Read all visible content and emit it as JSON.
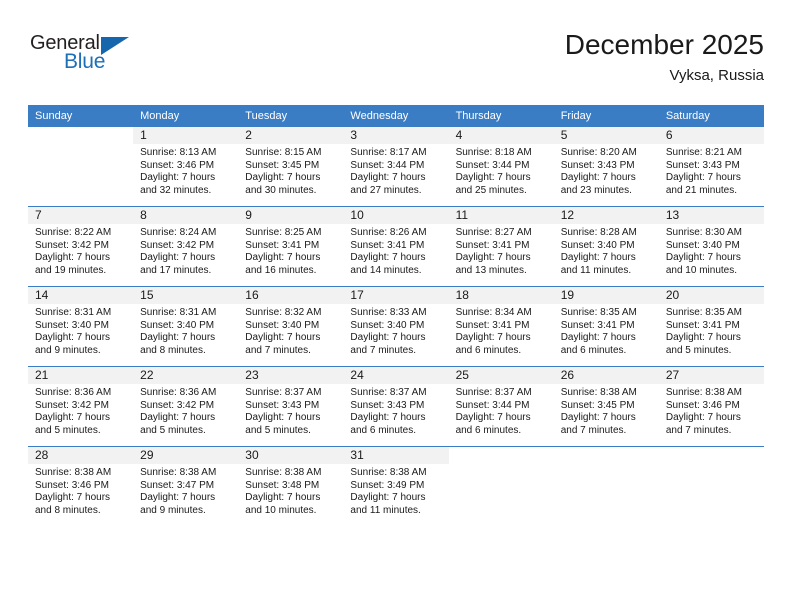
{
  "brand": {
    "name_top": "General",
    "name_bottom": "Blue",
    "accent_color": "#1566ac",
    "text_color": "#231f20"
  },
  "header": {
    "title": "December 2025",
    "location": "Vyksa, Russia"
  },
  "theme": {
    "header_row_bg": "#3b7dc4",
    "daynum_band_bg": "#f2f2f2",
    "text_color": "#1a1a1a"
  },
  "weekdays": [
    "Sunday",
    "Monday",
    "Tuesday",
    "Wednesday",
    "Thursday",
    "Friday",
    "Saturday"
  ],
  "labels": {
    "sunrise_prefix": "Sunrise:",
    "sunset_prefix": "Sunset:",
    "daylight_prefix": "Daylight:"
  },
  "weeks": [
    [
      {
        "day": "",
        "blank": true,
        "sunrise": "",
        "sunset": "",
        "daylight_line1": "",
        "daylight_line2": ""
      },
      {
        "day": "1",
        "sunrise": "Sunrise: 8:13 AM",
        "sunset": "Sunset: 3:46 PM",
        "daylight_line1": "Daylight: 7 hours",
        "daylight_line2": "and 32 minutes."
      },
      {
        "day": "2",
        "sunrise": "Sunrise: 8:15 AM",
        "sunset": "Sunset: 3:45 PM",
        "daylight_line1": "Daylight: 7 hours",
        "daylight_line2": "and 30 minutes."
      },
      {
        "day": "3",
        "sunrise": "Sunrise: 8:17 AM",
        "sunset": "Sunset: 3:44 PM",
        "daylight_line1": "Daylight: 7 hours",
        "daylight_line2": "and 27 minutes."
      },
      {
        "day": "4",
        "sunrise": "Sunrise: 8:18 AM",
        "sunset": "Sunset: 3:44 PM",
        "daylight_line1": "Daylight: 7 hours",
        "daylight_line2": "and 25 minutes."
      },
      {
        "day": "5",
        "sunrise": "Sunrise: 8:20 AM",
        "sunset": "Sunset: 3:43 PM",
        "daylight_line1": "Daylight: 7 hours",
        "daylight_line2": "and 23 minutes."
      },
      {
        "day": "6",
        "sunrise": "Sunrise: 8:21 AM",
        "sunset": "Sunset: 3:43 PM",
        "daylight_line1": "Daylight: 7 hours",
        "daylight_line2": "and 21 minutes."
      }
    ],
    [
      {
        "day": "7",
        "sunrise": "Sunrise: 8:22 AM",
        "sunset": "Sunset: 3:42 PM",
        "daylight_line1": "Daylight: 7 hours",
        "daylight_line2": "and 19 minutes."
      },
      {
        "day": "8",
        "sunrise": "Sunrise: 8:24 AM",
        "sunset": "Sunset: 3:42 PM",
        "daylight_line1": "Daylight: 7 hours",
        "daylight_line2": "and 17 minutes."
      },
      {
        "day": "9",
        "sunrise": "Sunrise: 8:25 AM",
        "sunset": "Sunset: 3:41 PM",
        "daylight_line1": "Daylight: 7 hours",
        "daylight_line2": "and 16 minutes."
      },
      {
        "day": "10",
        "sunrise": "Sunrise: 8:26 AM",
        "sunset": "Sunset: 3:41 PM",
        "daylight_line1": "Daylight: 7 hours",
        "daylight_line2": "and 14 minutes."
      },
      {
        "day": "11",
        "sunrise": "Sunrise: 8:27 AM",
        "sunset": "Sunset: 3:41 PM",
        "daylight_line1": "Daylight: 7 hours",
        "daylight_line2": "and 13 minutes."
      },
      {
        "day": "12",
        "sunrise": "Sunrise: 8:28 AM",
        "sunset": "Sunset: 3:40 PM",
        "daylight_line1": "Daylight: 7 hours",
        "daylight_line2": "and 11 minutes."
      },
      {
        "day": "13",
        "sunrise": "Sunrise: 8:30 AM",
        "sunset": "Sunset: 3:40 PM",
        "daylight_line1": "Daylight: 7 hours",
        "daylight_line2": "and 10 minutes."
      }
    ],
    [
      {
        "day": "14",
        "sunrise": "Sunrise: 8:31 AM",
        "sunset": "Sunset: 3:40 PM",
        "daylight_line1": "Daylight: 7 hours",
        "daylight_line2": "and 9 minutes."
      },
      {
        "day": "15",
        "sunrise": "Sunrise: 8:31 AM",
        "sunset": "Sunset: 3:40 PM",
        "daylight_line1": "Daylight: 7 hours",
        "daylight_line2": "and 8 minutes."
      },
      {
        "day": "16",
        "sunrise": "Sunrise: 8:32 AM",
        "sunset": "Sunset: 3:40 PM",
        "daylight_line1": "Daylight: 7 hours",
        "daylight_line2": "and 7 minutes."
      },
      {
        "day": "17",
        "sunrise": "Sunrise: 8:33 AM",
        "sunset": "Sunset: 3:40 PM",
        "daylight_line1": "Daylight: 7 hours",
        "daylight_line2": "and 7 minutes."
      },
      {
        "day": "18",
        "sunrise": "Sunrise: 8:34 AM",
        "sunset": "Sunset: 3:41 PM",
        "daylight_line1": "Daylight: 7 hours",
        "daylight_line2": "and 6 minutes."
      },
      {
        "day": "19",
        "sunrise": "Sunrise: 8:35 AM",
        "sunset": "Sunset: 3:41 PM",
        "daylight_line1": "Daylight: 7 hours",
        "daylight_line2": "and 6 minutes."
      },
      {
        "day": "20",
        "sunrise": "Sunrise: 8:35 AM",
        "sunset": "Sunset: 3:41 PM",
        "daylight_line1": "Daylight: 7 hours",
        "daylight_line2": "and 5 minutes."
      }
    ],
    [
      {
        "day": "21",
        "sunrise": "Sunrise: 8:36 AM",
        "sunset": "Sunset: 3:42 PM",
        "daylight_line1": "Daylight: 7 hours",
        "daylight_line2": "and 5 minutes."
      },
      {
        "day": "22",
        "sunrise": "Sunrise: 8:36 AM",
        "sunset": "Sunset: 3:42 PM",
        "daylight_line1": "Daylight: 7 hours",
        "daylight_line2": "and 5 minutes."
      },
      {
        "day": "23",
        "sunrise": "Sunrise: 8:37 AM",
        "sunset": "Sunset: 3:43 PM",
        "daylight_line1": "Daylight: 7 hours",
        "daylight_line2": "and 5 minutes."
      },
      {
        "day": "24",
        "sunrise": "Sunrise: 8:37 AM",
        "sunset": "Sunset: 3:43 PM",
        "daylight_line1": "Daylight: 7 hours",
        "daylight_line2": "and 6 minutes."
      },
      {
        "day": "25",
        "sunrise": "Sunrise: 8:37 AM",
        "sunset": "Sunset: 3:44 PM",
        "daylight_line1": "Daylight: 7 hours",
        "daylight_line2": "and 6 minutes."
      },
      {
        "day": "26",
        "sunrise": "Sunrise: 8:38 AM",
        "sunset": "Sunset: 3:45 PM",
        "daylight_line1": "Daylight: 7 hours",
        "daylight_line2": "and 7 minutes."
      },
      {
        "day": "27",
        "sunrise": "Sunrise: 8:38 AM",
        "sunset": "Sunset: 3:46 PM",
        "daylight_line1": "Daylight: 7 hours",
        "daylight_line2": "and 7 minutes."
      }
    ],
    [
      {
        "day": "28",
        "sunrise": "Sunrise: 8:38 AM",
        "sunset": "Sunset: 3:46 PM",
        "daylight_line1": "Daylight: 7 hours",
        "daylight_line2": "and 8 minutes."
      },
      {
        "day": "29",
        "sunrise": "Sunrise: 8:38 AM",
        "sunset": "Sunset: 3:47 PM",
        "daylight_line1": "Daylight: 7 hours",
        "daylight_line2": "and 9 minutes."
      },
      {
        "day": "30",
        "sunrise": "Sunrise: 8:38 AM",
        "sunset": "Sunset: 3:48 PM",
        "daylight_line1": "Daylight: 7 hours",
        "daylight_line2": "and 10 minutes."
      },
      {
        "day": "31",
        "sunrise": "Sunrise: 8:38 AM",
        "sunset": "Sunset: 3:49 PM",
        "daylight_line1": "Daylight: 7 hours",
        "daylight_line2": "and 11 minutes."
      },
      {
        "day": "",
        "blank": true,
        "sunrise": "",
        "sunset": "",
        "daylight_line1": "",
        "daylight_line2": ""
      },
      {
        "day": "",
        "blank": true,
        "sunrise": "",
        "sunset": "",
        "daylight_line1": "",
        "daylight_line2": ""
      },
      {
        "day": "",
        "blank": true,
        "sunrise": "",
        "sunset": "",
        "daylight_line1": "",
        "daylight_line2": ""
      }
    ]
  ]
}
